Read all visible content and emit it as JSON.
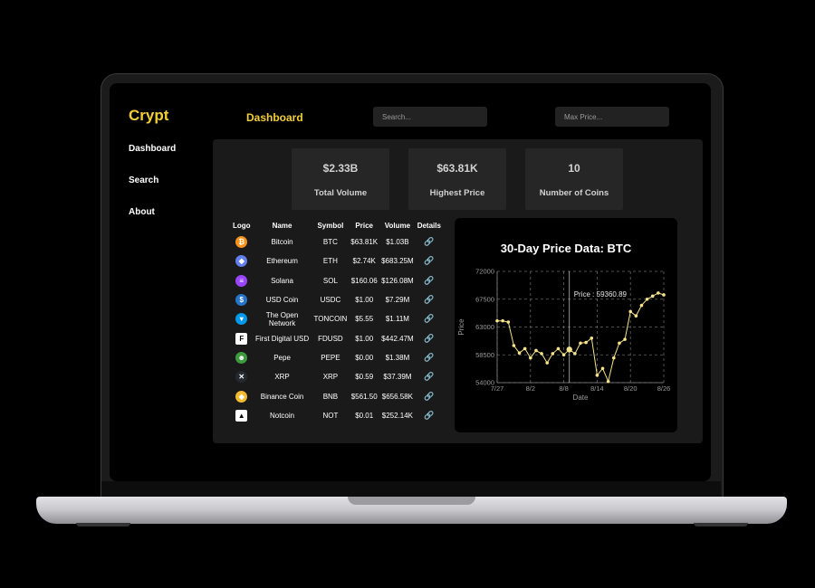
{
  "app": {
    "brand": "Crypt",
    "page_title": "Dashboard"
  },
  "sidebar": {
    "items": [
      {
        "label": "Dashboard"
      },
      {
        "label": "Search"
      },
      {
        "label": "About"
      }
    ]
  },
  "search": {
    "placeholder": "Search...",
    "max_price_placeholder": "Max Price..."
  },
  "stats": [
    {
      "value": "$2.33B",
      "label": "Total Volume"
    },
    {
      "value": "$63.81K",
      "label": "Highest Price"
    },
    {
      "value": "10",
      "label": "Number of Coins"
    }
  ],
  "table": {
    "headers": [
      "Logo",
      "Name",
      "Symbol",
      "Price",
      "Volume",
      "Details"
    ],
    "rows": [
      {
        "icon": "bitcoin-icon",
        "color": "#f7931a",
        "glyph": "₿",
        "name": "Bitcoin",
        "symbol": "BTC",
        "price": "$63.81K",
        "volume": "$1.03B"
      },
      {
        "icon": "ethereum-icon",
        "color": "#627eea",
        "glyph": "◆",
        "name": "Ethereum",
        "symbol": "ETH",
        "price": "$2.74K",
        "volume": "$683.25M"
      },
      {
        "icon": "solana-icon",
        "color": "#9945ff",
        "glyph": "≡",
        "name": "Solana",
        "symbol": "SOL",
        "price": "$160.06",
        "volume": "$126.08M"
      },
      {
        "icon": "usd-coin-icon",
        "color": "#2775ca",
        "glyph": "$",
        "name": "USD Coin",
        "symbol": "USDC",
        "price": "$1.00",
        "volume": "$7.29M"
      },
      {
        "icon": "toncoin-icon",
        "color": "#0098ea",
        "glyph": "▾",
        "name": "The Open Network",
        "symbol": "TONCOIN",
        "price": "$5.55",
        "volume": "$1.11M"
      },
      {
        "icon": "fdusd-icon",
        "color": "#ffffff",
        "glyph": "F",
        "name": "First Digital USD",
        "symbol": "FDUSD",
        "price": "$1.00",
        "volume": "$442.47M"
      },
      {
        "icon": "pepe-icon",
        "color": "#3d9a3d",
        "glyph": "☻",
        "name": "Pepe",
        "symbol": "PEPE",
        "price": "$0.00",
        "volume": "$1.38M"
      },
      {
        "icon": "xrp-icon",
        "color": "#23292f",
        "glyph": "✕",
        "name": "XRP",
        "symbol": "XRP",
        "price": "$0.59",
        "volume": "$37.39M"
      },
      {
        "icon": "binance-coin-icon",
        "color": "#f3ba2f",
        "glyph": "◆",
        "name": "Binance Coin",
        "symbol": "BNB",
        "price": "$561.50",
        "volume": "$656.58K"
      },
      {
        "icon": "notcoin-icon",
        "color": "#ffffff",
        "glyph": "▲",
        "name": "Notcoin",
        "symbol": "NOT",
        "price": "$0.01",
        "volume": "$252.14K"
      }
    ],
    "details_icon": "link-icon"
  },
  "chart_data": {
    "type": "line",
    "title": "30-Day Price Data: BTC",
    "xlabel": "Date",
    "ylabel": "Price",
    "ylim": [
      54000,
      72000
    ],
    "yticks": [
      "72000",
      "67500",
      "63000",
      "58500",
      "54000"
    ],
    "xticks": [
      "7/27",
      "8/2",
      "8/8",
      "8/14",
      "8/20",
      "8/26"
    ],
    "x": [
      "7/27",
      "7/28",
      "7/29",
      "7/30",
      "7/31",
      "8/1",
      "8/2",
      "8/3",
      "8/4",
      "8/5",
      "8/6",
      "8/7",
      "8/8",
      "8/9",
      "8/10",
      "8/11",
      "8/12",
      "8/13",
      "8/14",
      "8/15",
      "8/16",
      "8/17",
      "8/18",
      "8/19",
      "8/20",
      "8/21",
      "8/22",
      "8/23",
      "8/24",
      "8/25",
      "8/26"
    ],
    "values": [
      64000,
      64000,
      63800,
      60000,
      58800,
      59500,
      58000,
      59200,
      58700,
      57200,
      58700,
      59500,
      58500,
      59360.89,
      58700,
      60400,
      60500,
      61200,
      55200,
      56300,
      54200,
      58000,
      60400,
      61000,
      65500,
      64800,
      66500,
      67500,
      68000,
      68500,
      68200
    ],
    "tooltip": "Price : 59360.89",
    "grid": true,
    "line_color": "#f5e28a"
  }
}
